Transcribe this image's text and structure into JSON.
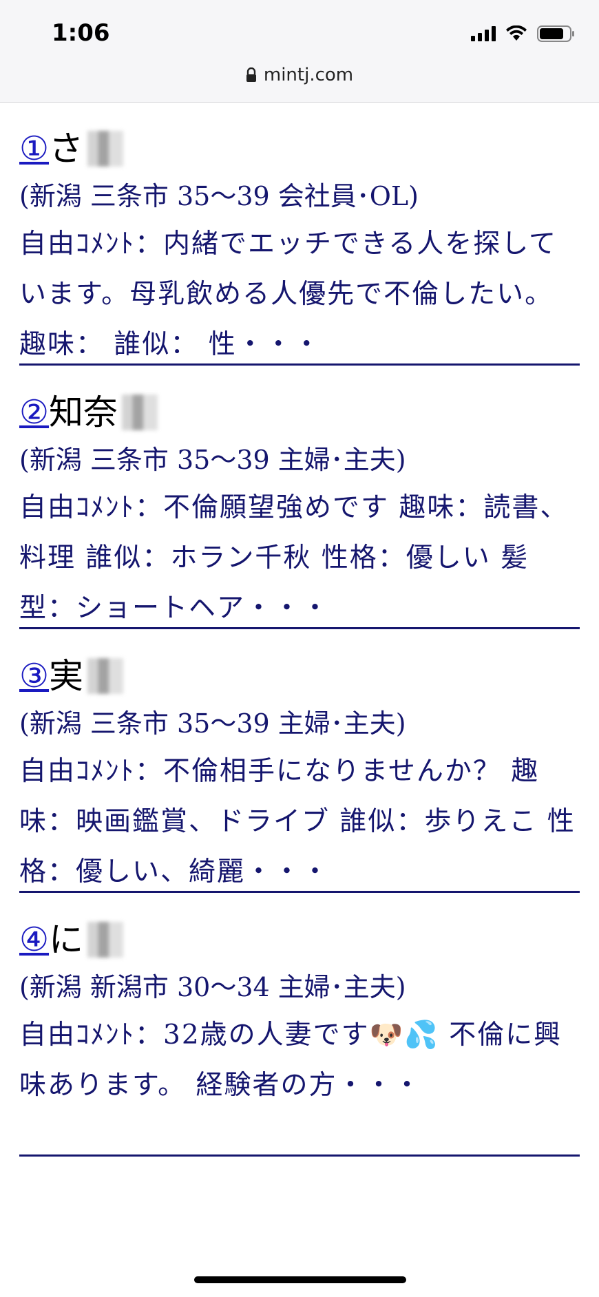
{
  "status_bar": {
    "time": "1:06",
    "url": "mintj.com"
  },
  "entries": [
    {
      "number": "①",
      "name": "さ",
      "meta": "(新潟 三条市 35～39 会社員･OL)",
      "comment": "自由ｺﾒﾝﾄ：内緒でエッチできる人を探しています。母乳飲める人優先で不倫したい。 趣味： 誰似： 性・・・"
    },
    {
      "number": "②",
      "name": "知奈",
      "meta": "(新潟 三条市 35～39 主婦･主夫)",
      "comment": "自由ｺﾒﾝﾄ：不倫願望強めです 趣味：読書、料理 誰似：ホラン千秋 性格：優しい 髪型：ショートヘア・・・"
    },
    {
      "number": "③",
      "name": "実",
      "meta": "(新潟 三条市 35～39 主婦･主夫)",
      "comment": "自由ｺﾒﾝﾄ：不倫相手になりませんか？ 趣味：映画鑑賞、ドライブ 誰似：歩りえこ 性格：優しい、綺麗・・・"
    },
    {
      "number": "④",
      "name": "に",
      "meta": "(新潟 新潟市 30～34 主婦･主夫)",
      "comment": "自由ｺﾒﾝﾄ：32歳の人妻です🐶💦 不倫に興味あります。 経験者の方・・・"
    }
  ],
  "colors": {
    "text": "#15166e",
    "link": "#1a1ac0",
    "divider": "#15166e"
  }
}
